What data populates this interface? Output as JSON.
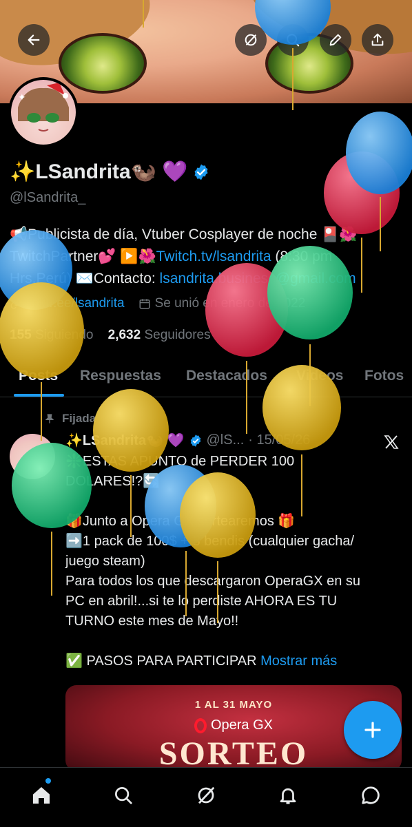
{
  "profile": {
    "display_name": "✨LSandrita🦦 💜",
    "handle": "@lSandrita_",
    "bio_line1_a": "📢Publicista de día, Vtuber Cosplayer de noche 🎴🌺",
    "bio_line2_a": "TwitchPartner💕 ▶️🌺",
    "bio_link": "Twitch.tv/lsandrita",
    "bio_line2_b": " (8:30 pm",
    "bio_line3_a": "Hrs.Perú) ✉️Contacto: ",
    "bio_email": "lsandrita.business@gmail.com",
    "website": "linktr.ee/lsandrita",
    "joined": "Se unió en enero de 2022",
    "following_count": "155",
    "following_label": "Siguiendo",
    "followers_count": "2,632",
    "followers_label": "Seguidores"
  },
  "tabs": [
    "Posts",
    "Respuestas",
    "Destacados",
    "Videos",
    "Fotos"
  ],
  "pinned": {
    "label": "Fijada",
    "author": "✨LSandrita🦦 💜",
    "handle": "@lS...",
    "date": "· 15/05/26",
    "lines": [
      "❇️ESTAS APUNTO de PERDER 100",
      "DOLARES!?🔄",
      "",
      "🎁Junto a Opera GX sortearemos 🎁",
      "➡️1 pack de 100$ + 8 bendis (cualquier gacha/",
      "juego steam)",
      "Para todos los que descargaron OperaGX en su",
      "PC en abril!...si te lo perdiste AHORA ES TU",
      "TURNO este mes de Mayo!!",
      ""
    ],
    "last_line": "✅ PASOS PARA PARTICIPAR ",
    "show_more": "Mostrar más",
    "card": {
      "dates": "1 AL 31 MAYO",
      "brand": "Opera GX",
      "headline": "SORTEO"
    }
  },
  "colors": {
    "accent": "#1d9bf0",
    "background": "#000000",
    "text": "#e7e9ea",
    "muted": "#71767b"
  },
  "icons": {
    "back": "arrow-left-icon",
    "grok": "grok-icon",
    "search": "search-icon",
    "edit": "pencil-icon",
    "share": "share-icon",
    "verified": "verified-badge-icon",
    "home": "home-icon",
    "notifications": "bell-icon",
    "messages": "message-icon",
    "compose": "plus-icon",
    "x_logo": "x-logo-icon",
    "pin": "pin-icon",
    "link": "link-icon",
    "calendar": "calendar-icon"
  }
}
